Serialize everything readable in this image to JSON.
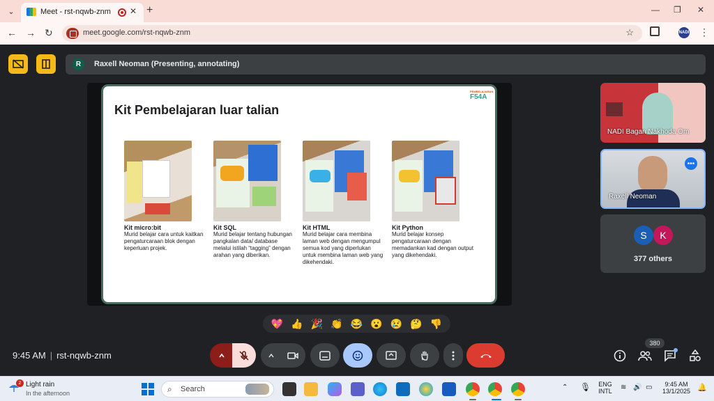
{
  "browser": {
    "tab_title": "Meet - rst-nqwb-znm",
    "url": "meet.google.com/rst-nqwb-znm",
    "profile_initials": "NADI"
  },
  "meet": {
    "presenter_initial": "R",
    "presenter_label": "Raxell Neoman (Presenting, annotating)",
    "time": "9:45 AM",
    "meeting_code": "rst-nqwb-znm",
    "people_count": "380",
    "colors": {
      "accent_yellow": "#f6b91a",
      "leave_red": "#dc3b2f",
      "active_blue": "#a8c7fa",
      "mic_off_pink": "#f9dedc"
    }
  },
  "slide": {
    "title": "Kit Pembelajaran luar talian",
    "logo": "F54A",
    "logo_caption": "PEMBELAJARAN",
    "kits": [
      {
        "name": "Kit micro:bit",
        "desc": "Murid belajar cara untuk kaitkan pengaturcaraan blok dengan keperluan projek."
      },
      {
        "name": "Kit SQL",
        "desc": "Murid belajar tentang hubungan pangkalan data/ database melalui istilah “tagging” dengan arahan yang diberikan."
      },
      {
        "name": "Kit HTML",
        "desc": "Murid belajar cara membina laman web dengan mengumpul semua kod yang diperlukan untuk membina laman web yang dikehendaki."
      },
      {
        "name": "Kit Python",
        "desc": "Murid belajar konsep pengaturcaraan dengan memadankan kad dengan output yang dikehendaki."
      }
    ]
  },
  "participants": {
    "tile1_name": "NADI Bagan Nakhoda Om",
    "tile2_name": "Raxell Neoman",
    "others_avatars": [
      "S",
      "K"
    ],
    "others_label": "377 others"
  },
  "reactions": [
    "💖",
    "👍",
    "🎉",
    "👏",
    "😂",
    "😮",
    "😢",
    "🤔",
    "👎"
  ],
  "taskbar": {
    "weather_badge": "2",
    "weather_main": "Light rain",
    "weather_sub": "In the afternoon",
    "search_placeholder": "Search",
    "lang_top": "ENG",
    "lang_bottom": "INTL",
    "clock_time": "9:45 AM",
    "clock_date": "13/1/2025"
  }
}
